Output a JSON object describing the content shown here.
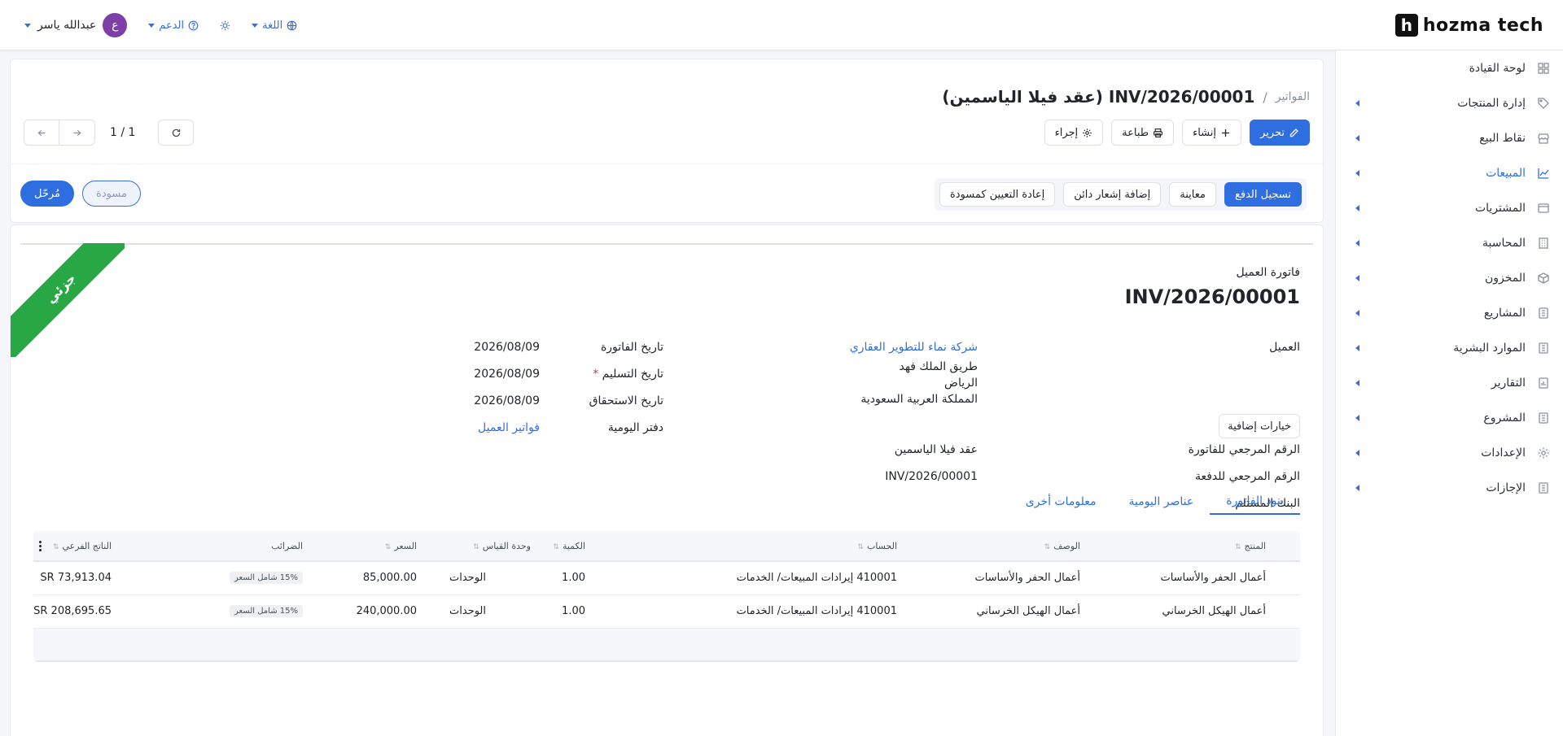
{
  "brand": {
    "name": "hozma tech",
    "mark": "h"
  },
  "topbar": {
    "user_name": "عبدالله ياسر",
    "user_initial": "ع",
    "support_label": "الدعم",
    "language_label": "اللغة"
  },
  "sidebar": {
    "items": [
      {
        "label": "لوحة القيادة",
        "icon": "grid-icon",
        "has_children": false,
        "active": false
      },
      {
        "label": "إدارة المنتجات",
        "icon": "tag-icon",
        "has_children": true,
        "active": false
      },
      {
        "label": "نقاط البيع",
        "icon": "store-icon",
        "has_children": true,
        "active": false
      },
      {
        "label": "المبيعات",
        "icon": "chart-line-icon",
        "has_children": true,
        "active": true
      },
      {
        "label": "المشتريات",
        "icon": "wallet-icon",
        "has_children": true,
        "active": false
      },
      {
        "label": "المحاسبة",
        "icon": "building-icon",
        "has_children": true,
        "active": false
      },
      {
        "label": "المخزون",
        "icon": "box-icon",
        "has_children": true,
        "active": false
      },
      {
        "label": "المشاريع",
        "icon": "document-icon",
        "has_children": true,
        "active": false
      },
      {
        "label": "الموارد البشرية",
        "icon": "document-icon",
        "has_children": true,
        "active": false
      },
      {
        "label": "التقارير",
        "icon": "report-icon",
        "has_children": true,
        "active": false
      },
      {
        "label": "المشروع",
        "icon": "document-icon",
        "has_children": true,
        "active": false
      },
      {
        "label": "الإعدادات",
        "icon": "gear-icon",
        "has_children": true,
        "active": false
      },
      {
        "label": "الإجازات",
        "icon": "document-icon",
        "has_children": true,
        "active": false
      }
    ]
  },
  "breadcrumb": {
    "parent": "الفواتير",
    "separator": "/",
    "current": "INV/2026/00001 (عقد فيلا الياسمين)"
  },
  "toolbar": {
    "edit_label": "تحرير",
    "create_label": "إنشاء",
    "print_label": "طباعة",
    "action_label": "إجراء"
  },
  "pager": {
    "count": "1 / 1"
  },
  "actions": {
    "register_payment": "تسجيل الدفع",
    "preview": "معاينة",
    "add_credit_note": "إضافة إشعار دائن",
    "reset_to_draft": "إعادة التعيين كمسودة"
  },
  "status": {
    "draft": "مسودة",
    "posted": "مُرحّل"
  },
  "invoice": {
    "ribbon": "جزئي",
    "type_label": "فاتورة العميل",
    "number": "INV/2026/00001",
    "customer_label": "العميل",
    "customer_name": "شركة نماء للتطوير العقاري",
    "address_line1": "طريق الملك فهد",
    "address_line2": "الرياض",
    "address_line3": "المملكة العربية السعودية",
    "invoice_date_label": "تاريخ الفاتورة",
    "invoice_date": "2026/08/09",
    "delivery_date_label": "تاريخ التسليم",
    "required_mark": "*",
    "delivery_date": "2026/08/09",
    "due_date_label": "تاريخ الاستحقاق",
    "due_date": "2026/08/09",
    "journal_label": "دفتر اليومية",
    "journal": "فواتير العميل",
    "extra_options": "خيارات إضافية",
    "invoice_ref_label": "الرقم المرجعي للفاتورة",
    "invoice_ref": "عقد فيلا الياسمين",
    "payment_ref_label": "الرقم المرجعي للدفعة",
    "payment_ref": "INV/2026/00001",
    "bank_label": "البنك المستلم"
  },
  "tabs": [
    {
      "label": "بنود الفاتورة",
      "active": true
    },
    {
      "label": "عناصر اليومية",
      "active": false
    },
    {
      "label": "معلومات أخرى",
      "active": false
    }
  ],
  "table": {
    "headers": {
      "product": "المنتج",
      "description": "الوصف",
      "account": "الحساب",
      "quantity": "الكمية",
      "uom": "وحدة القياس",
      "price": "السعر",
      "taxes": "الضرائب",
      "subtotal": "الناتج الفرعي"
    },
    "rows": [
      {
        "product": "أعمال الحفر والأساسات",
        "description": "أعمال الحفر والأساسات",
        "account": "410001 إيرادات المبيعات/ الخدمات",
        "quantity": "1.00",
        "uom": "الوحدات",
        "price": "85,000.00",
        "tax": "15% شامل السعر",
        "subtotal": "SR 73,913.04"
      },
      {
        "product": "أعمال الهيكل الخرساني",
        "description": "أعمال الهيكل الخرساني",
        "account": "410001 إيرادات المبيعات/ الخدمات",
        "quantity": "1.00",
        "uom": "الوحدات",
        "price": "240,000.00",
        "tax": "15% شامل السعر",
        "subtotal": "SR 208,695.65"
      }
    ]
  },
  "colors": {
    "primary": "#2f6ee0",
    "ribbon": "#28a745",
    "avatar": "#7c3fa8"
  }
}
